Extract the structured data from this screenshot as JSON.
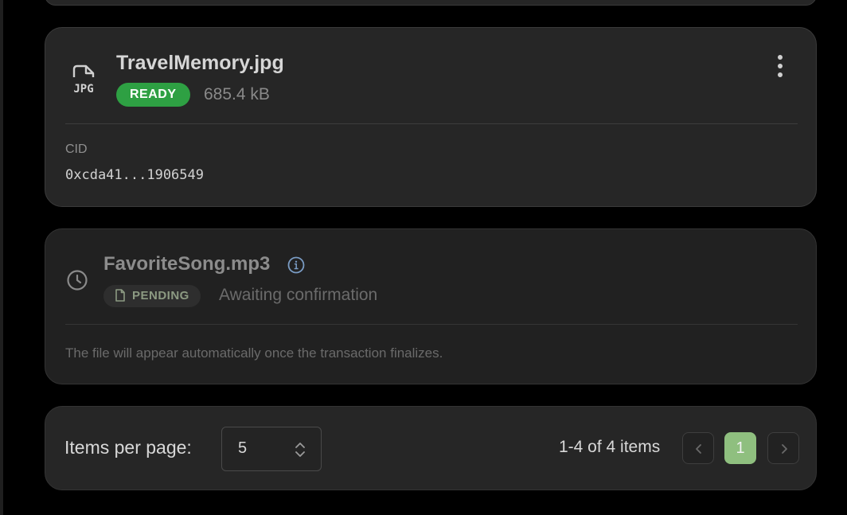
{
  "files": [
    {
      "name": "TravelMemory.jpg",
      "icon": "jpg-file-icon",
      "status": "READY",
      "size": "685.4 kB",
      "cid_label": "CID",
      "cid_value": "0xcda41...1906549"
    },
    {
      "name": "FavoriteSong.mp3",
      "icon": "clock-icon",
      "status": "PENDING",
      "status_text": "Awaiting confirmation",
      "note": "The file will appear automatically once the transaction finalizes."
    }
  ],
  "pagination": {
    "items_per_page_label": "Items per page:",
    "items_per_page_value": "5",
    "range_text": "1-4 of 4 items",
    "current_page": "1"
  },
  "colors": {
    "ready_badge": "#2ea043",
    "current_page": "#8fbf7f",
    "card_bg": "#262626",
    "page_bg": "#000000"
  }
}
